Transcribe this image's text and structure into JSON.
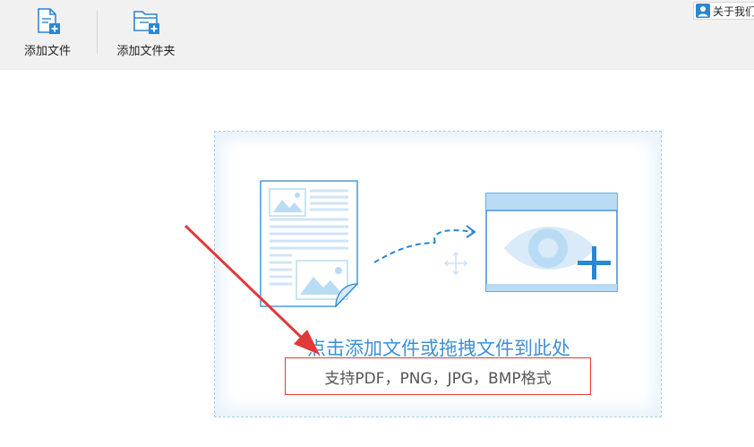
{
  "toolbar": {
    "add_file_label": "添加文件",
    "add_folder_label": "添加文件夹"
  },
  "header": {
    "about_label": "关于我们"
  },
  "dropzone": {
    "main_text": "点击添加文件或拖拽文件到此处",
    "hint_text": "支持PDF，PNG，JPG，BMP格式"
  },
  "icons": {
    "add_file": "file-plus-icon",
    "add_folder": "folder-plus-icon",
    "about": "user-icon",
    "document": "document-image-icon",
    "move": "move-cross-icon",
    "preview": "eye-window-icon",
    "plus": "plus-icon",
    "annotation": "red-arrow-annotation"
  },
  "colors": {
    "accent_blue": "#3f8fd6",
    "icon_blue": "#2b86d2",
    "light_blue": "#b9dcf4",
    "annotation_red": "#e0393a",
    "toolbar_bg": "#f1f1f1"
  }
}
